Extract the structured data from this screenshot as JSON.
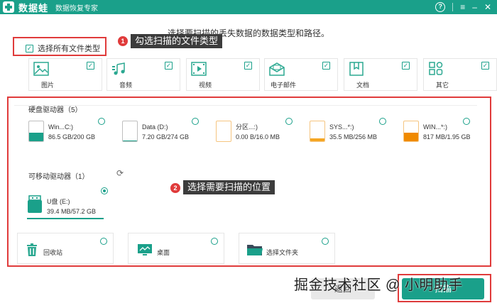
{
  "titlebar": {
    "app_name": "数据蛙",
    "subtitle": "数据恢复专家",
    "help": "?",
    "menu": "≡",
    "minimize": "–",
    "close": "✕"
  },
  "instruction": "选择要扫描的丢失数据的数据类型和路径。",
  "select_all": {
    "label": "选择所有文件类型",
    "checked": true
  },
  "annotations": [
    {
      "badge": "1",
      "text": "勾选扫描的文件类型"
    },
    {
      "badge": "2",
      "text": "选择需要扫描的位置"
    }
  ],
  "file_types": [
    {
      "label": "图片",
      "icon": "image-icon",
      "checked": true
    },
    {
      "label": "音频",
      "icon": "music-icon",
      "checked": true
    },
    {
      "label": "视频",
      "icon": "video-icon",
      "checked": true
    },
    {
      "label": "电子邮件",
      "icon": "mail-icon",
      "checked": true
    },
    {
      "label": "文档",
      "icon": "document-icon",
      "checked": true
    },
    {
      "label": "其它",
      "icon": "other-icon",
      "checked": true
    }
  ],
  "hard_drives": {
    "title": "硬盘驱动器（5）",
    "items": [
      {
        "name": "Win...C:)",
        "usage": "86.5 GB/200 GB",
        "fill": 0.43,
        "color": "#1aa08a",
        "selected": false
      },
      {
        "name": "Data (D:)",
        "usage": "7.20 GB/274 GB",
        "fill": 0.03,
        "color": "#1aa08a",
        "selected": false
      },
      {
        "name": "分区...:)",
        "usage": "0.00  B/16.0 MB",
        "fill": 0.0,
        "color": "#f5a623",
        "selected": false
      },
      {
        "name": "SYS...*:)",
        "usage": "35.5 MB/256 MB",
        "fill": 0.14,
        "color": "#f5a623",
        "selected": false
      },
      {
        "name": "WIN...*:)",
        "usage": "817 MB/1.95 GB",
        "fill": 0.42,
        "color": "#f08a00",
        "selected": false
      }
    ]
  },
  "removable_drives": {
    "title": "可移动驱动器（1）",
    "items": [
      {
        "name": "U盘 (E:)",
        "usage": "39.4 MB/57.2 GB",
        "fill": 0.01,
        "selected": true
      }
    ]
  },
  "locations": [
    {
      "label": "回收站",
      "icon": "recycle-bin-icon",
      "selected": false
    },
    {
      "label": "桌面",
      "icon": "desktop-icon",
      "selected": false
    },
    {
      "label": "选择文件夹",
      "icon": "folder-icon",
      "selected": false
    }
  ],
  "watermark": "掘金技术社区 @ 小明助手",
  "buttons": {
    "back": "返回",
    "scan": "扫描"
  },
  "colors": {
    "accent": "#1aa08a",
    "annotation_red": "#e03b3b",
    "warning_orange": "#f5a623"
  }
}
